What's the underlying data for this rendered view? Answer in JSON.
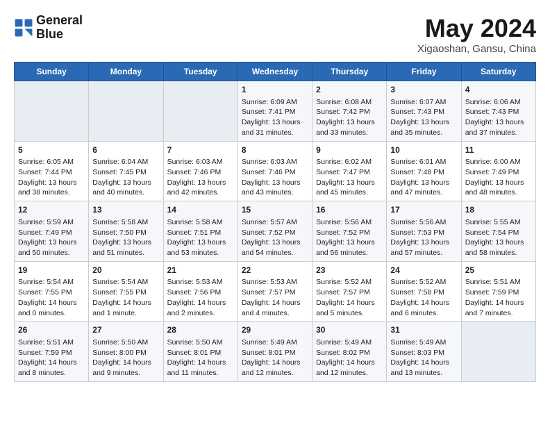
{
  "logo": {
    "line1": "General",
    "line2": "Blue"
  },
  "title": "May 2024",
  "location": "Xigaoshan, Gansu, China",
  "weekdays": [
    "Sunday",
    "Monday",
    "Tuesday",
    "Wednesday",
    "Thursday",
    "Friday",
    "Saturday"
  ],
  "weeks": [
    [
      {
        "day": "",
        "content": ""
      },
      {
        "day": "",
        "content": ""
      },
      {
        "day": "",
        "content": ""
      },
      {
        "day": "1",
        "content": "Sunrise: 6:09 AM\nSunset: 7:41 PM\nDaylight: 13 hours\nand 31 minutes."
      },
      {
        "day": "2",
        "content": "Sunrise: 6:08 AM\nSunset: 7:42 PM\nDaylight: 13 hours\nand 33 minutes."
      },
      {
        "day": "3",
        "content": "Sunrise: 6:07 AM\nSunset: 7:43 PM\nDaylight: 13 hours\nand 35 minutes."
      },
      {
        "day": "4",
        "content": "Sunrise: 6:06 AM\nSunset: 7:43 PM\nDaylight: 13 hours\nand 37 minutes."
      }
    ],
    [
      {
        "day": "5",
        "content": "Sunrise: 6:05 AM\nSunset: 7:44 PM\nDaylight: 13 hours\nand 38 minutes."
      },
      {
        "day": "6",
        "content": "Sunrise: 6:04 AM\nSunset: 7:45 PM\nDaylight: 13 hours\nand 40 minutes."
      },
      {
        "day": "7",
        "content": "Sunrise: 6:03 AM\nSunset: 7:46 PM\nDaylight: 13 hours\nand 42 minutes."
      },
      {
        "day": "8",
        "content": "Sunrise: 6:03 AM\nSunset: 7:46 PM\nDaylight: 13 hours\nand 43 minutes."
      },
      {
        "day": "9",
        "content": "Sunrise: 6:02 AM\nSunset: 7:47 PM\nDaylight: 13 hours\nand 45 minutes."
      },
      {
        "day": "10",
        "content": "Sunrise: 6:01 AM\nSunset: 7:48 PM\nDaylight: 13 hours\nand 47 minutes."
      },
      {
        "day": "11",
        "content": "Sunrise: 6:00 AM\nSunset: 7:49 PM\nDaylight: 13 hours\nand 48 minutes."
      }
    ],
    [
      {
        "day": "12",
        "content": "Sunrise: 5:59 AM\nSunset: 7:49 PM\nDaylight: 13 hours\nand 50 minutes."
      },
      {
        "day": "13",
        "content": "Sunrise: 5:58 AM\nSunset: 7:50 PM\nDaylight: 13 hours\nand 51 minutes."
      },
      {
        "day": "14",
        "content": "Sunrise: 5:58 AM\nSunset: 7:51 PM\nDaylight: 13 hours\nand 53 minutes."
      },
      {
        "day": "15",
        "content": "Sunrise: 5:57 AM\nSunset: 7:52 PM\nDaylight: 13 hours\nand 54 minutes."
      },
      {
        "day": "16",
        "content": "Sunrise: 5:56 AM\nSunset: 7:52 PM\nDaylight: 13 hours\nand 56 minutes."
      },
      {
        "day": "17",
        "content": "Sunrise: 5:56 AM\nSunset: 7:53 PM\nDaylight: 13 hours\nand 57 minutes."
      },
      {
        "day": "18",
        "content": "Sunrise: 5:55 AM\nSunset: 7:54 PM\nDaylight: 13 hours\nand 58 minutes."
      }
    ],
    [
      {
        "day": "19",
        "content": "Sunrise: 5:54 AM\nSunset: 7:55 PM\nDaylight: 14 hours\nand 0 minutes."
      },
      {
        "day": "20",
        "content": "Sunrise: 5:54 AM\nSunset: 7:55 PM\nDaylight: 14 hours\nand 1 minute."
      },
      {
        "day": "21",
        "content": "Sunrise: 5:53 AM\nSunset: 7:56 PM\nDaylight: 14 hours\nand 2 minutes."
      },
      {
        "day": "22",
        "content": "Sunrise: 5:53 AM\nSunset: 7:57 PM\nDaylight: 14 hours\nand 4 minutes."
      },
      {
        "day": "23",
        "content": "Sunrise: 5:52 AM\nSunset: 7:57 PM\nDaylight: 14 hours\nand 5 minutes."
      },
      {
        "day": "24",
        "content": "Sunrise: 5:52 AM\nSunset: 7:58 PM\nDaylight: 14 hours\nand 6 minutes."
      },
      {
        "day": "25",
        "content": "Sunrise: 5:51 AM\nSunset: 7:59 PM\nDaylight: 14 hours\nand 7 minutes."
      }
    ],
    [
      {
        "day": "26",
        "content": "Sunrise: 5:51 AM\nSunset: 7:59 PM\nDaylight: 14 hours\nand 8 minutes."
      },
      {
        "day": "27",
        "content": "Sunrise: 5:50 AM\nSunset: 8:00 PM\nDaylight: 14 hours\nand 9 minutes."
      },
      {
        "day": "28",
        "content": "Sunrise: 5:50 AM\nSunset: 8:01 PM\nDaylight: 14 hours\nand 11 minutes."
      },
      {
        "day": "29",
        "content": "Sunrise: 5:49 AM\nSunset: 8:01 PM\nDaylight: 14 hours\nand 12 minutes."
      },
      {
        "day": "30",
        "content": "Sunrise: 5:49 AM\nSunset: 8:02 PM\nDaylight: 14 hours\nand 12 minutes."
      },
      {
        "day": "31",
        "content": "Sunrise: 5:49 AM\nSunset: 8:03 PM\nDaylight: 14 hours\nand 13 minutes."
      },
      {
        "day": "",
        "content": ""
      }
    ]
  ]
}
